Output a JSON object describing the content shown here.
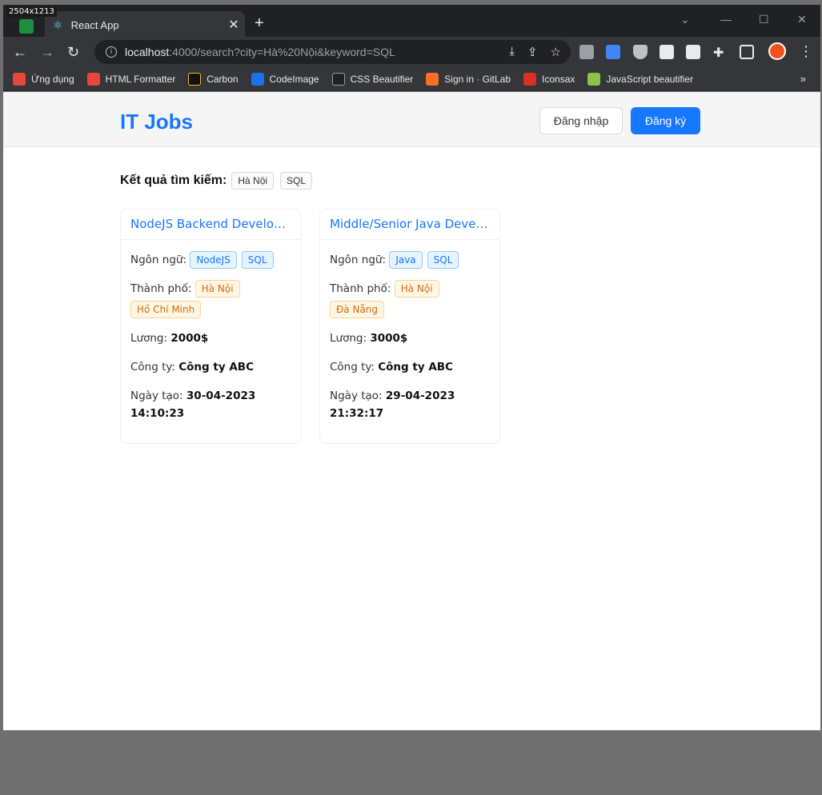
{
  "overlay": {
    "dims": "2504x1213"
  },
  "browser": {
    "tab_title": "React App",
    "url_host": "localhost",
    "url_rest": ":4000/search?city=Hà%20Nội&keyword=SQL",
    "bookmarks": [
      {
        "label": "Ứng dụng",
        "color": "#e8453c"
      },
      {
        "label": "HTML Formatter",
        "color": "#e8453c"
      },
      {
        "label": "Carbon",
        "color": "#111111"
      },
      {
        "label": "CodeImage",
        "color": "#1a73e8"
      },
      {
        "label": "CSS Beautifier",
        "color": "#202124"
      },
      {
        "label": "Sign in · GitLab",
        "color": "#fc6d26"
      },
      {
        "label": "Iconsax",
        "color": "#d93025"
      },
      {
        "label": "JavaScript beautifier",
        "color": "#8bc34a"
      }
    ],
    "bookmarks_more": "»"
  },
  "header": {
    "logo": "IT Jobs",
    "login": "Đăng nhập",
    "signup": "Đăng ký"
  },
  "search": {
    "label": "Kết quả tìm kiếm:",
    "tags": [
      "Hà Nội",
      "SQL"
    ]
  },
  "jobs": [
    {
      "title": "NodeJS Backend Developer ...",
      "lang_label": "Ngôn ngữ:",
      "langs": [
        "NodeJS",
        "SQL"
      ],
      "city_label": "Thành phố:",
      "cities": [
        "Hà Nội",
        "Hồ Chí Minh"
      ],
      "salary_label": "Lương:",
      "salary": "2000$",
      "company_label": "Công ty:",
      "company": "Công ty ABC",
      "date_label": "Ngày tạo:",
      "date": "30-04-2023",
      "time": "14:10:23"
    },
    {
      "title": "Middle/Senior Java Developer",
      "lang_label": "Ngôn ngữ:",
      "langs": [
        "Java",
        "SQL"
      ],
      "city_label": "Thành phố:",
      "cities": [
        "Hà Nội",
        "Đà Nẵng"
      ],
      "salary_label": "Lương:",
      "salary": "3000$",
      "company_label": "Công ty:",
      "company": "Công ty ABC",
      "date_label": "Ngày tạo:",
      "date": "29-04-2023",
      "time": "21:32:17"
    }
  ]
}
